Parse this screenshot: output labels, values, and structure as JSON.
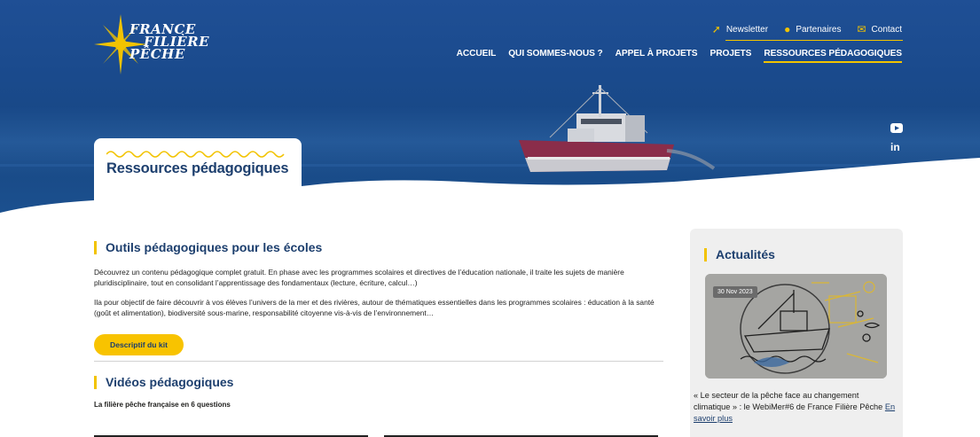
{
  "brand": {
    "logo_lines": [
      "FRANCE",
      "FILIÈRE",
      "PÊCHE"
    ],
    "colors": {
      "primary": "#1d3f6e",
      "accent": "#f2c300",
      "hero": "#1a4a8c"
    }
  },
  "top_links": [
    {
      "label": "Newsletter",
      "icon": "paper-plane-icon"
    },
    {
      "label": "Partenaires",
      "icon": "people-icon"
    },
    {
      "label": "Contact",
      "icon": "envelope-icon"
    }
  ],
  "main_nav": [
    {
      "label": "ACCUEIL",
      "active": false
    },
    {
      "label": "QUI SOMMES-NOUS ?",
      "active": false
    },
    {
      "label": "APPEL À PROJETS",
      "active": false
    },
    {
      "label": "PROJETS",
      "active": false
    },
    {
      "label": "RESSOURCES PÉDAGOGIQUES",
      "active": true
    }
  ],
  "social": {
    "youtube_icon": "youtube-icon",
    "linkedin_label": "in"
  },
  "page_title": "Ressources pédagogiques",
  "main": {
    "tools_title": "Outils pédagogiques pour les écoles",
    "para1": "Découvrez un contenu pédagogique complet gratuit. En phase avec les programmes scolaires et directives de l’éducation nationale, il traite les sujets de manière pluridisciplinaire, tout en consolidant l’apprentissage des fondamentaux (lecture, écriture, calcul…)",
    "para2": "Ila pour objectif de faire découvrir à vos élèves l’univers de la mer et des rivières, autour de thématiques essentielles dans les programmes scolaires : éducation à la santé (goût et alimentation), biodiversité sous-marine, responsabilité citoyenne vis-à-vis de l’environnement…",
    "kit_button": "Descriptif du kit",
    "videos_title": "Vidéos pédagogiques",
    "video_caption": "La filière pêche française en 6 questions"
  },
  "sidebar": {
    "title": "Actualités",
    "news": {
      "date": "30 Nov 2023",
      "text": "« Le secteur de la pêche face au changement climatique » : le WebiMer#6 de France Filière Pêche",
      "more": "En savoir plus"
    }
  }
}
